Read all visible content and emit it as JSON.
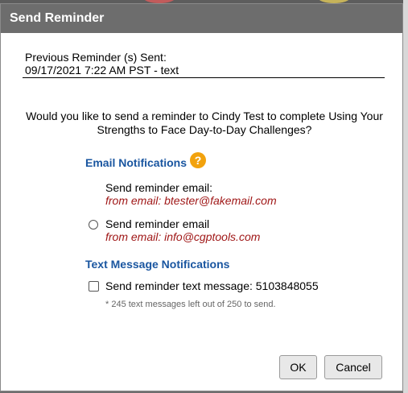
{
  "dialog": {
    "title": "Send Reminder",
    "previous_label": "Previous Reminder (s) Sent:",
    "previous_value": "09/17/2021 7:22 AM PST - text",
    "question": "Would you like to send a reminder to Cindy Test to complete Using Your Strengths to Face Day-to-Day Challenges?"
  },
  "email_section": {
    "title": "Email Notifications",
    "help_icon": "?",
    "option1_label": "Send reminder email:",
    "option1_from": "from email: btester@fakemail.com",
    "option2_label": "Send reminder email",
    "option2_from": "from email: info@cgptools.com",
    "option2_selected": false
  },
  "text_section": {
    "title": "Text Message Notifications",
    "option_label": "Send reminder text message: 5103848055",
    "option_checked": false,
    "note": "* 245 text messages left out of 250 to send."
  },
  "buttons": {
    "ok": "OK",
    "cancel": "Cancel"
  },
  "colors": {
    "titlebar": "#6d6d6d",
    "section_title": "#1a56a0",
    "email_text": "#a01818",
    "help_icon": "#f2a20d"
  }
}
